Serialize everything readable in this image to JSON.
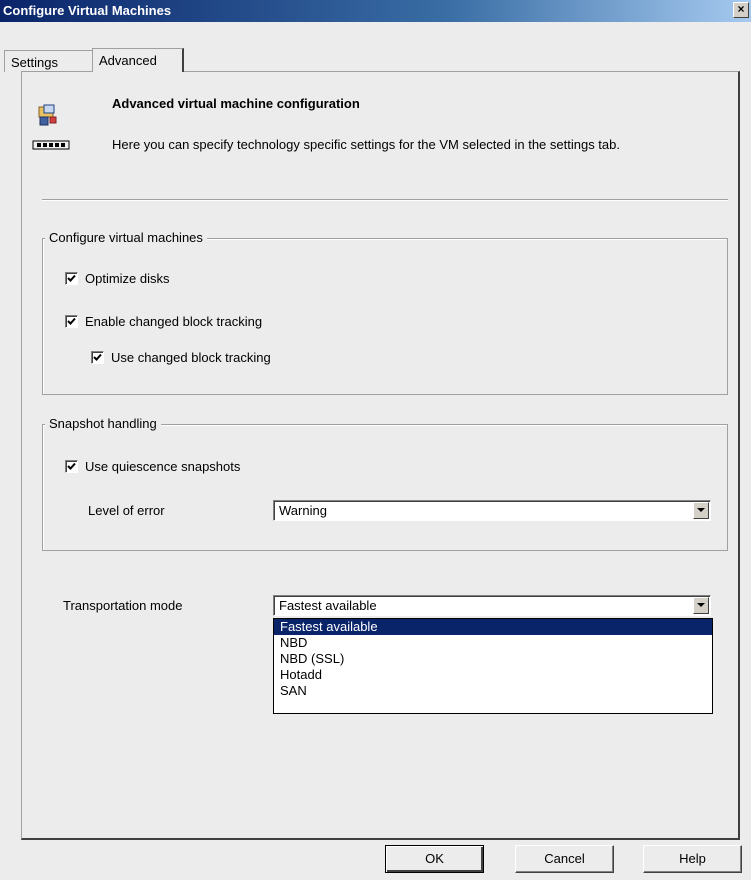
{
  "window": {
    "title": "Configure Virtual Machines",
    "close_label": "✕"
  },
  "tabs": [
    {
      "label": "Settings",
      "selected": false
    },
    {
      "label": "Advanced",
      "selected": true
    }
  ],
  "header": {
    "title": "Advanced virtual machine configuration",
    "description": "Here you can specify technology specific settings for the VM selected in the settings tab.",
    "icon": "server-config-icon"
  },
  "configure_group": {
    "legend": "Configure virtual machines",
    "optimize_disks": {
      "label": "Optimize disks",
      "checked": true
    },
    "enable_cbt": {
      "label": "Enable changed block tracking",
      "checked": true
    },
    "use_cbt": {
      "label": "Use changed block tracking",
      "checked": true
    }
  },
  "snapshot_group": {
    "legend": "Snapshot handling",
    "quiescence": {
      "label": "Use quiescence snapshots",
      "checked": true
    },
    "level_of_error": {
      "label": "Level of error",
      "value": "Warning"
    }
  },
  "transportation": {
    "label": "Transportation mode",
    "value": "Fastest available",
    "options": [
      "Fastest available",
      "NBD",
      "NBD (SSL)",
      "Hotadd",
      "SAN"
    ],
    "highlighted_index": 0
  },
  "buttons": {
    "ok": "OK",
    "cancel": "Cancel",
    "help": "Help"
  },
  "colors": {
    "titlebar": "#0a246a",
    "selection": "#0a246a",
    "dialog_bg": "#ececec"
  }
}
